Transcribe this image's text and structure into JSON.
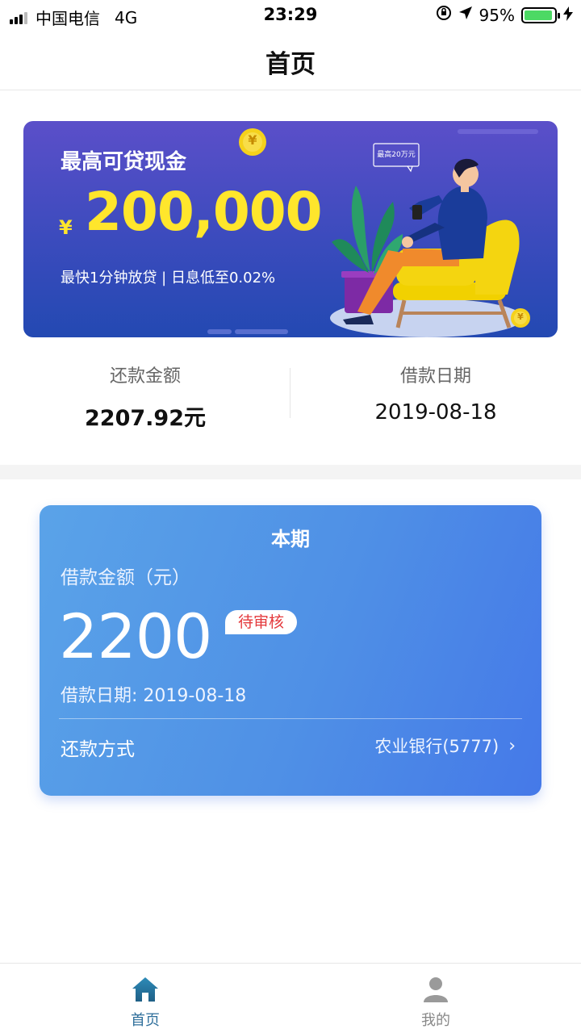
{
  "status_bar": {
    "carrier": "中国电信",
    "network": "4G",
    "time": "23:29",
    "battery": "95%",
    "battery_level": 0.95,
    "icons": [
      "signal-icon",
      "lock-rotation-icon",
      "location-icon",
      "battery-icon",
      "charging-icon"
    ]
  },
  "nav": {
    "title": "首页"
  },
  "banner": {
    "subtitle": "最高可贷现金",
    "currency": "¥",
    "amount": "200,000",
    "description": "最快1分钟放贷 | 日息低至0.02%",
    "bubble_text": "最高20万元",
    "coin_symbol": "¥"
  },
  "summary": {
    "repay_label": "还款金额",
    "repay_value": "2207.92元",
    "date_label": "借款日期",
    "date_value": "2019-08-18"
  },
  "loan_card": {
    "title": "本期",
    "amount_label": "借款金额（元）",
    "amount": "2200",
    "status": "待审核",
    "date_text": "借款日期: 2019-08-18",
    "pay_label": "还款方式",
    "pay_method": "农业银行(5777)",
    "chevron": "›"
  },
  "tabs": [
    {
      "label": "首页",
      "icon": "home-icon",
      "active": true
    },
    {
      "label": "我的",
      "icon": "user-icon",
      "active": false
    }
  ],
  "colors": {
    "accent_yellow": "#ffe62c",
    "card_blue": "#4f90e6",
    "status_red": "#e4393c",
    "tab_active": "#2f6f9b"
  }
}
